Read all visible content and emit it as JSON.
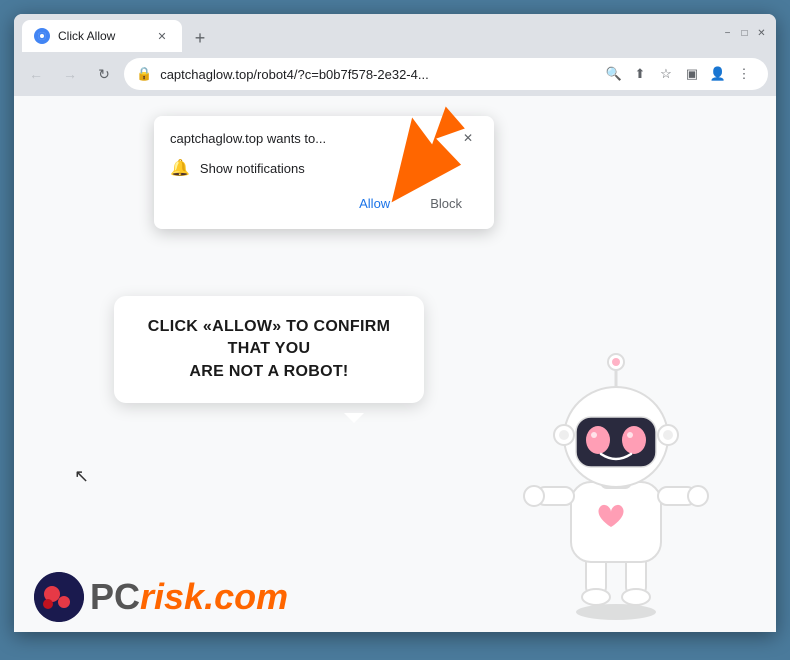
{
  "browser": {
    "tab": {
      "title": "Click Allow",
      "favicon_label": "chrome-favicon"
    },
    "new_tab_label": "+",
    "window_controls": {
      "minimize": "−",
      "maximize": "□",
      "close": "✕"
    },
    "toolbar": {
      "back_arrow": "←",
      "forward_arrow": "→",
      "refresh": "↻",
      "address": "captchaglow.top/robot4/?c=b0b7f578-2e32-4...",
      "search_icon": "🔍",
      "share_icon": "⬆",
      "bookmark_icon": "☆",
      "extensions_icon": "▣",
      "profile_icon": "👤",
      "menu_icon": "⋮"
    },
    "notification_popup": {
      "site_text": "captchaglow.top wants to...",
      "bell_icon": "🔔",
      "show_notifications": "Show notifications",
      "allow_btn": "Allow",
      "block_btn": "Block",
      "close_icon": "✕"
    },
    "speech_bubble": {
      "line1": "CLICK «ALLOW» TO CONFIRM THAT YOU",
      "line2": "ARE NOT A ROBOT!"
    },
    "logo": {
      "pc_text": "PC",
      "risk_text": "risk",
      "domain": ".com"
    }
  }
}
